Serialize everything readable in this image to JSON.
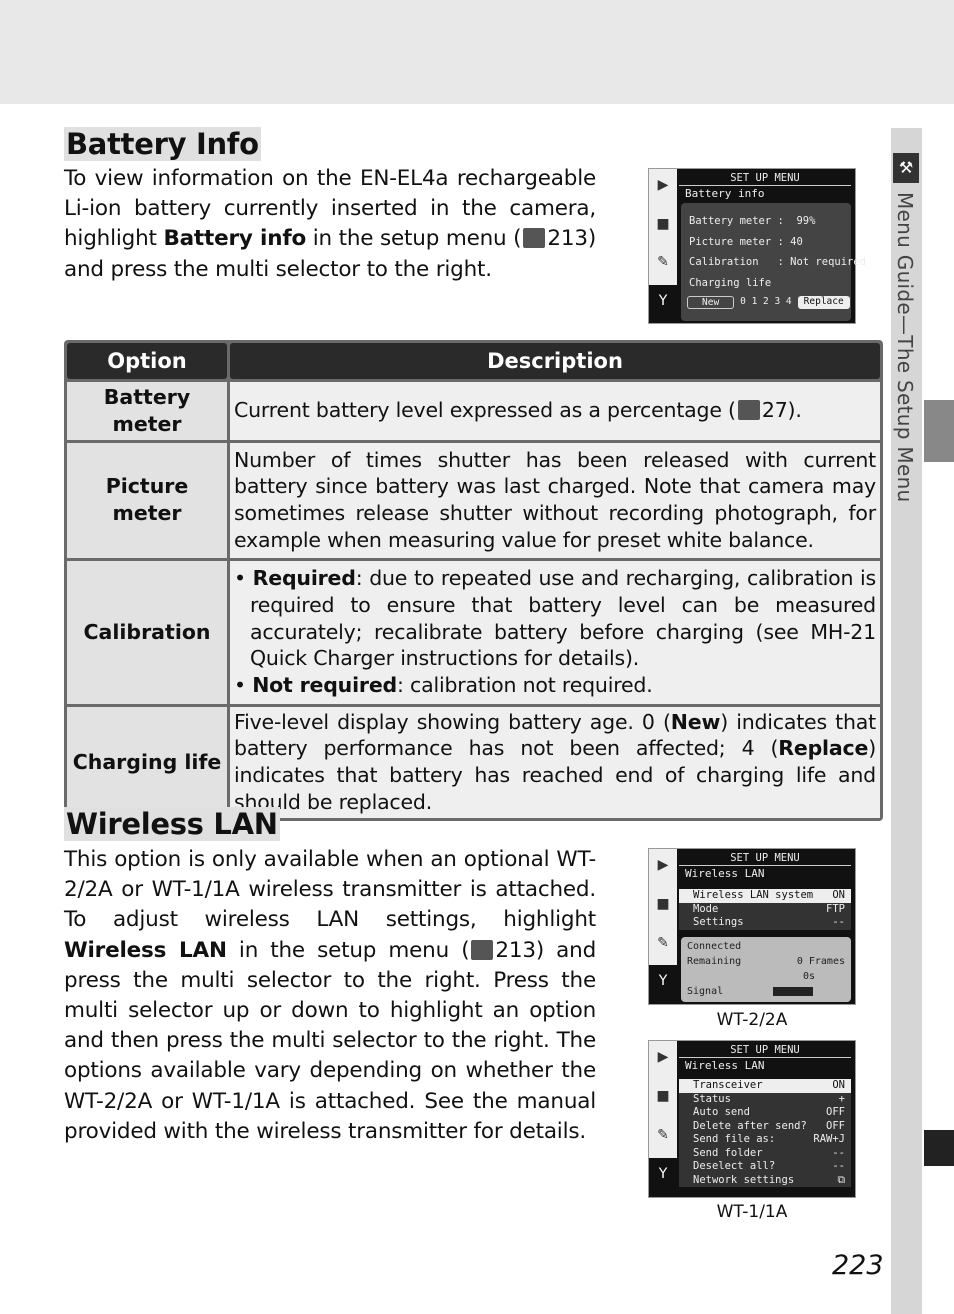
{
  "battery": {
    "title": "Battery Info",
    "p1": "To view information on the EN-EL4a rechargeable Li-ion battery currently inserted in the camera, highlight ",
    "p_bold": "Battery info",
    "p2": " in the setup menu (",
    "p_ref": "213",
    "p3": ") and press the multi selector to the right.",
    "screen": {
      "title": "SET UP MENU",
      "subtitle": "Battery info",
      "lines": [
        "Battery meter :  99%",
        "Picture meter : 40",
        "Calibration   : Not required",
        "Charging life"
      ],
      "scale_left": "New",
      "scale_ticks": "0 1 2 3 4",
      "scale_right": "Replace",
      "current_level": 0
    }
  },
  "table": {
    "headers": [
      "Option",
      "Description"
    ],
    "rows": [
      {
        "option": "Battery meter",
        "desc_a": "Current battery level expressed as a percentage (",
        "desc_ref": "27",
        "desc_b": ")."
      },
      {
        "option": "Picture meter",
        "desc": "Number of times shutter has been released with current battery since battery was last charged.  Note that camera may sometimes release shutter without recording photograph, for example when measuring value for preset white balance."
      },
      {
        "option": "Calibration",
        "b1_bold": "Required",
        "b1": ": due to repeated use and recharging, calibration is required to ensure that battery level can be measured accurately; recalibrate battery before charging (see MH-21 Quick Charger instructions for details).",
        "b2_bold": "Not required",
        "b2": ": calibration not required."
      },
      {
        "option": "Charging life",
        "d1": "Five-level display showing battery age.  0 (",
        "d1b": "New",
        "d2": ") indicates that battery performance has not been affected; 4 (",
        "d2b": "Replace",
        "d3": ") indicates that battery has reached end of charging life and should be replaced."
      }
    ]
  },
  "wireless": {
    "title": "Wireless LAN",
    "p1": "This option is only available when an optional WT-2/2A or WT-1/1A wireless transmitter is attached.  To adjust wireless LAN settings, highlight ",
    "p_bold": "Wireless LAN",
    "p2": " in the setup menu (",
    "p_ref": "213",
    "p3": ") and press the multi selector to the right.  Press the multi selector up or down to highlight an option and then press the multi selector to the right.  The options available vary depending on whether the WT-2/2A or WT-1/1A is attached.  See the manual provided with the wireless transmitter for details.",
    "screen1": {
      "title": "SET UP MENU",
      "subtitle": "Wireless LAN",
      "items": [
        [
          "Wireless LAN system",
          "ON"
        ],
        [
          "Mode",
          "FTP"
        ],
        [
          "Settings",
          "--"
        ]
      ],
      "status": {
        "connected": "Connected",
        "remaining": "Remaining",
        "frames": "0 Frames",
        "time": "0s",
        "signal": "Signal"
      },
      "caption": "WT-2/2A"
    },
    "screen2": {
      "title": "SET UP MENU",
      "subtitle": "Wireless LAN",
      "items": [
        [
          "Transceiver",
          "ON"
        ],
        [
          "Status",
          "+"
        ],
        [
          "Auto send",
          "OFF"
        ],
        [
          "Delete after send?",
          "OFF"
        ],
        [
          "Send file as:",
          "RAW+J"
        ],
        [
          "Send folder",
          "--"
        ],
        [
          "Deselect all?",
          "--"
        ],
        [
          "Network settings",
          "⧉"
        ]
      ],
      "caption": "WT-1/1A"
    }
  },
  "sidebar": {
    "label": "Menu Guide—The Setup Menu"
  },
  "page_number": "223"
}
